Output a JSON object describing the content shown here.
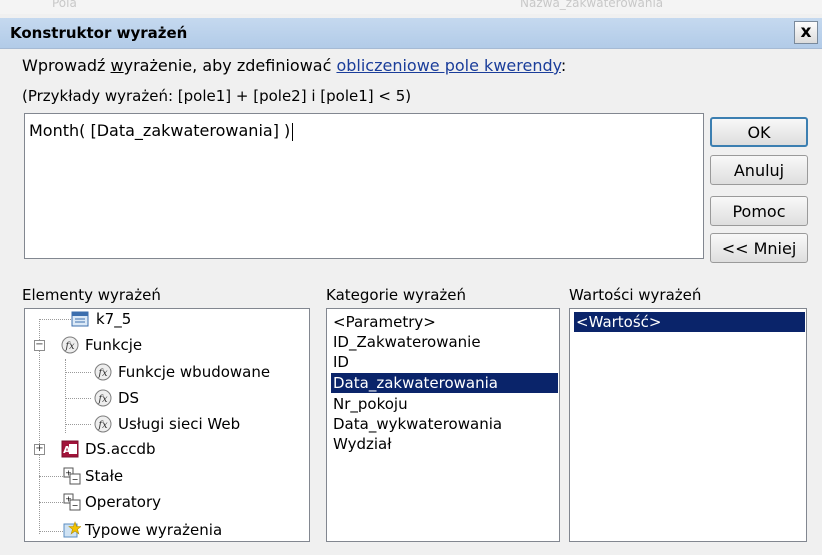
{
  "background_strip": {
    "left_text": "Pola",
    "right_text": "Nazwa_zakwaterowania"
  },
  "dialog": {
    "title": "Konstruktor wyrażeń",
    "close_symbol": "x",
    "intro": {
      "prefix": "Wprowadź ",
      "underlined": "w",
      "after_underlined": "yrażenie, aby zdefiniować ",
      "link": "obliczeniowe pole kwerendy",
      "suffix": ":"
    },
    "examples": "(Przykłady wyrażeń: [pole1] + [pole2] i [pole1] < 5)",
    "expression": "Month( [Data_zakwaterowania] )",
    "buttons": {
      "ok": "OK",
      "cancel": "Anuluj",
      "help": "Pomoc",
      "less": "<< Mniej"
    },
    "elements_label": "Elementy wyrażeń",
    "categories_label": "Kategorie wyrażeń",
    "values_label": "Wartości wyrażeń",
    "elements_tree": [
      {
        "label": "k7_5",
        "icon": "form-icon"
      },
      {
        "label": "Funkcje",
        "icon": "function-icon",
        "expander": "−"
      },
      {
        "label": "Funkcje wbudowane",
        "icon": "function-icon"
      },
      {
        "label": "DS",
        "icon": "function-icon"
      },
      {
        "label": "Usługi sieci Web",
        "icon": "function-icon"
      },
      {
        "label": "DS.accdb",
        "icon": "access-db-icon",
        "expander": "+"
      },
      {
        "label": "Stałe",
        "icon": "constants-icon"
      },
      {
        "label": "Operatory",
        "icon": "operators-icon"
      },
      {
        "label": "Typowe wyrażenia",
        "icon": "common-expressions-icon"
      }
    ],
    "categories": [
      "<Parametry>",
      "ID_Zakwaterowanie",
      "ID",
      "Data_zakwaterowania",
      "Nr_pokoju",
      "Data_wykwaterowania",
      "Wydział"
    ],
    "categories_selected": "Data_zakwaterowania",
    "values": [
      "<Wartość>"
    ],
    "values_selected": "<Wartość>",
    "colors": {
      "selection": "#0a246a",
      "link": "#1a3d9a",
      "titlebar": "#c5d9ef"
    }
  }
}
